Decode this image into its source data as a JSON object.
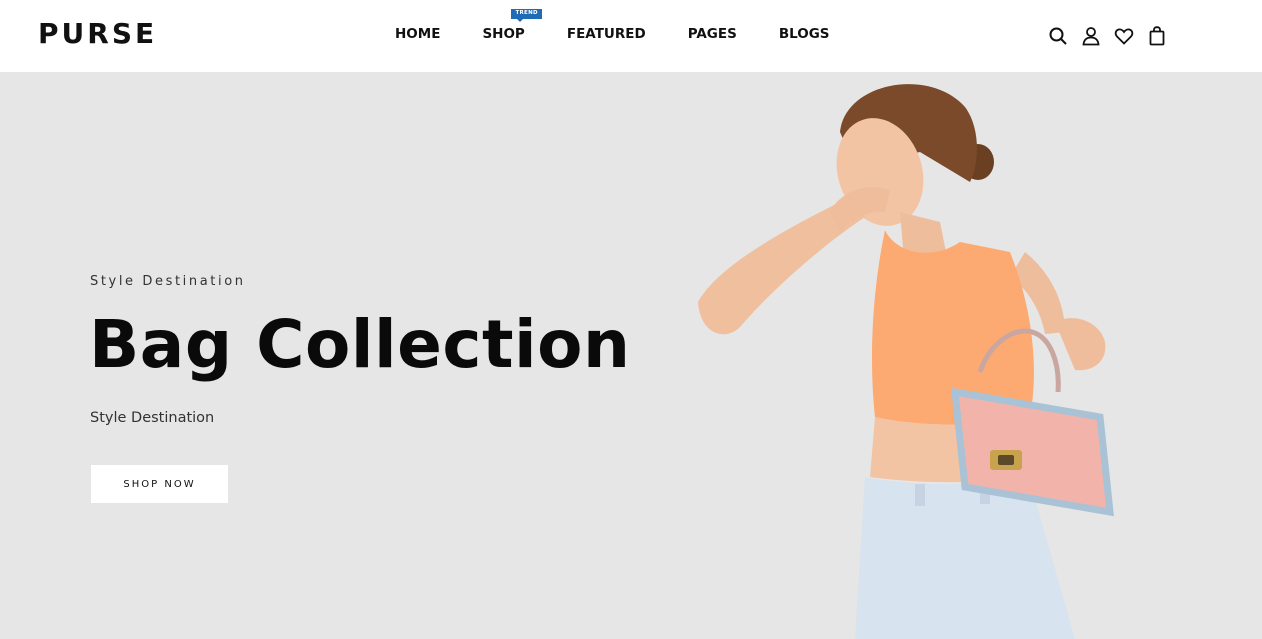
{
  "header": {
    "logo": "PURSE",
    "nav": [
      {
        "label": "HOME"
      },
      {
        "label": "SHOP",
        "badge": "TREND"
      },
      {
        "label": "FEATURED"
      },
      {
        "label": "PAGES"
      },
      {
        "label": "BLOGS"
      }
    ],
    "icons": [
      "search-icon",
      "user-icon",
      "heart-icon",
      "cart-icon"
    ],
    "badge_color": "#1f6bb6"
  },
  "hero": {
    "eyebrow": "Style Destination",
    "title": "Bag Collection",
    "subtitle": "Style Destination",
    "button_label": "SHOP NOW",
    "background": "#e6e6e6"
  }
}
